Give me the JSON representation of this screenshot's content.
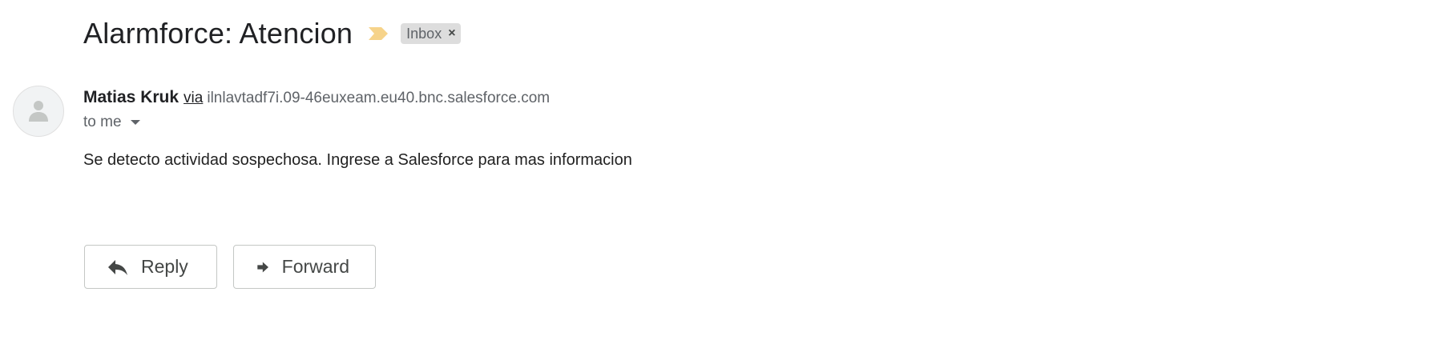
{
  "email": {
    "subject": "Alarmforce: Atencion",
    "importance_marker": "important-marker-icon",
    "label": {
      "name": "Inbox",
      "remove_glyph": "×"
    },
    "sender": {
      "name": "Matias Kruk",
      "via_text": "via",
      "via_domain": "ilnlavtadf7i.09-46euxeam.eu40.bnc.salesforce.com"
    },
    "recipient_text": "to me",
    "body": "Se detecto actividad sospechosa. Ingrese a Salesforce para mas informacion"
  },
  "actions": {
    "reply_label": "Reply",
    "forward_label": "Forward"
  },
  "colors": {
    "importance_marker": "#f6d38a",
    "label_chip_bg": "#dddddd",
    "avatar_bg": "#f1f3f4",
    "avatar_icon": "#c4c7c5"
  }
}
